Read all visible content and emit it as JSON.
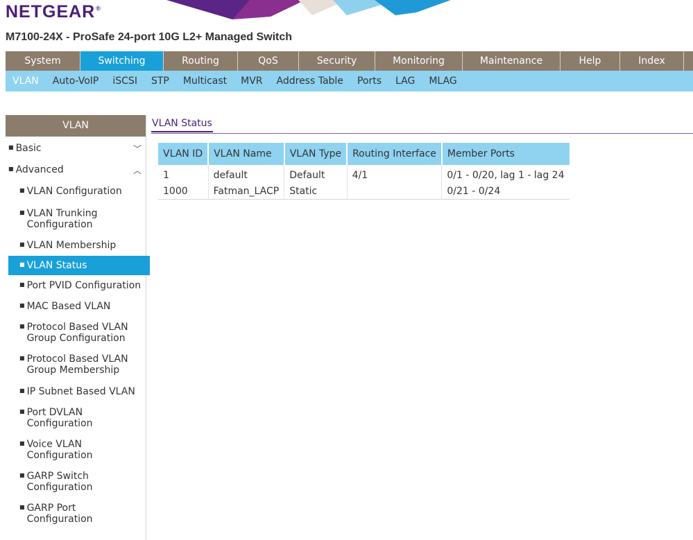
{
  "brand": {
    "logo_text": "NETGEAR"
  },
  "header": {
    "model": "M7100-24X - ProSafe 24-port 10G L2+ Managed Switch"
  },
  "main_nav": [
    {
      "label": "System",
      "active": false
    },
    {
      "label": "Switching",
      "active": true
    },
    {
      "label": "Routing",
      "active": false
    },
    {
      "label": "QoS",
      "active": false
    },
    {
      "label": "Security",
      "active": false
    },
    {
      "label": "Monitoring",
      "active": false
    },
    {
      "label": "Maintenance",
      "active": false
    },
    {
      "label": "Help",
      "active": false
    },
    {
      "label": "Index",
      "active": false
    }
  ],
  "sub_nav": [
    {
      "label": "VLAN",
      "active": true
    },
    {
      "label": "Auto-VoIP"
    },
    {
      "label": "iSCSI"
    },
    {
      "label": "STP"
    },
    {
      "label": "Multicast"
    },
    {
      "label": "MVR"
    },
    {
      "label": "Address Table"
    },
    {
      "label": "Ports"
    },
    {
      "label": "LAG"
    },
    {
      "label": "MLAG"
    }
  ],
  "sidebar": {
    "title": "VLAN",
    "groups": [
      {
        "label": "Basic",
        "expanded": false,
        "chevron_icon": "chevron-down-icon"
      },
      {
        "label": "Advanced",
        "expanded": true,
        "chevron_icon": "chevron-up-icon"
      }
    ],
    "items": [
      {
        "lines": [
          "VLAN Configuration"
        ]
      },
      {
        "lines": [
          "VLAN Trunking",
          "Configuration"
        ]
      },
      {
        "lines": [
          "VLAN Membership"
        ]
      },
      {
        "lines": [
          "VLAN Status"
        ],
        "active": true
      },
      {
        "lines": [
          "Port PVID Configuration"
        ]
      },
      {
        "lines": [
          "MAC Based VLAN"
        ]
      },
      {
        "lines": [
          "Protocol Based VLAN",
          "Group Configuration"
        ]
      },
      {
        "lines": [
          "Protocol Based VLAN",
          "Group Membership"
        ]
      },
      {
        "lines": [
          "IP Subnet Based VLAN"
        ]
      },
      {
        "lines": [
          "Port DVLAN",
          "Configuration"
        ]
      },
      {
        "lines": [
          "Voice VLAN",
          "Configuration"
        ]
      },
      {
        "lines": [
          "GARP Switch",
          "Configuration"
        ]
      },
      {
        "lines": [
          "GARP Port",
          "Configuration"
        ]
      }
    ]
  },
  "content": {
    "tab": "VLAN Status",
    "table": {
      "columns": [
        "VLAN ID",
        "VLAN Name",
        "VLAN Type",
        "Routing Interface",
        "Member Ports"
      ],
      "rows": [
        [
          "1",
          "default",
          "Default",
          "4/1",
          "0/1 - 0/20, lag 1 - lag 24"
        ],
        [
          "1000",
          "Fatman_LACP",
          "Static",
          "",
          "0/21 - 0/24"
        ]
      ]
    }
  },
  "colors": {
    "brand_purple": "#4a1e77",
    "nav_brown": "#8c7c6b",
    "active_blue": "#1aa0d8",
    "subnav_light_blue": "#8fd3f1"
  }
}
